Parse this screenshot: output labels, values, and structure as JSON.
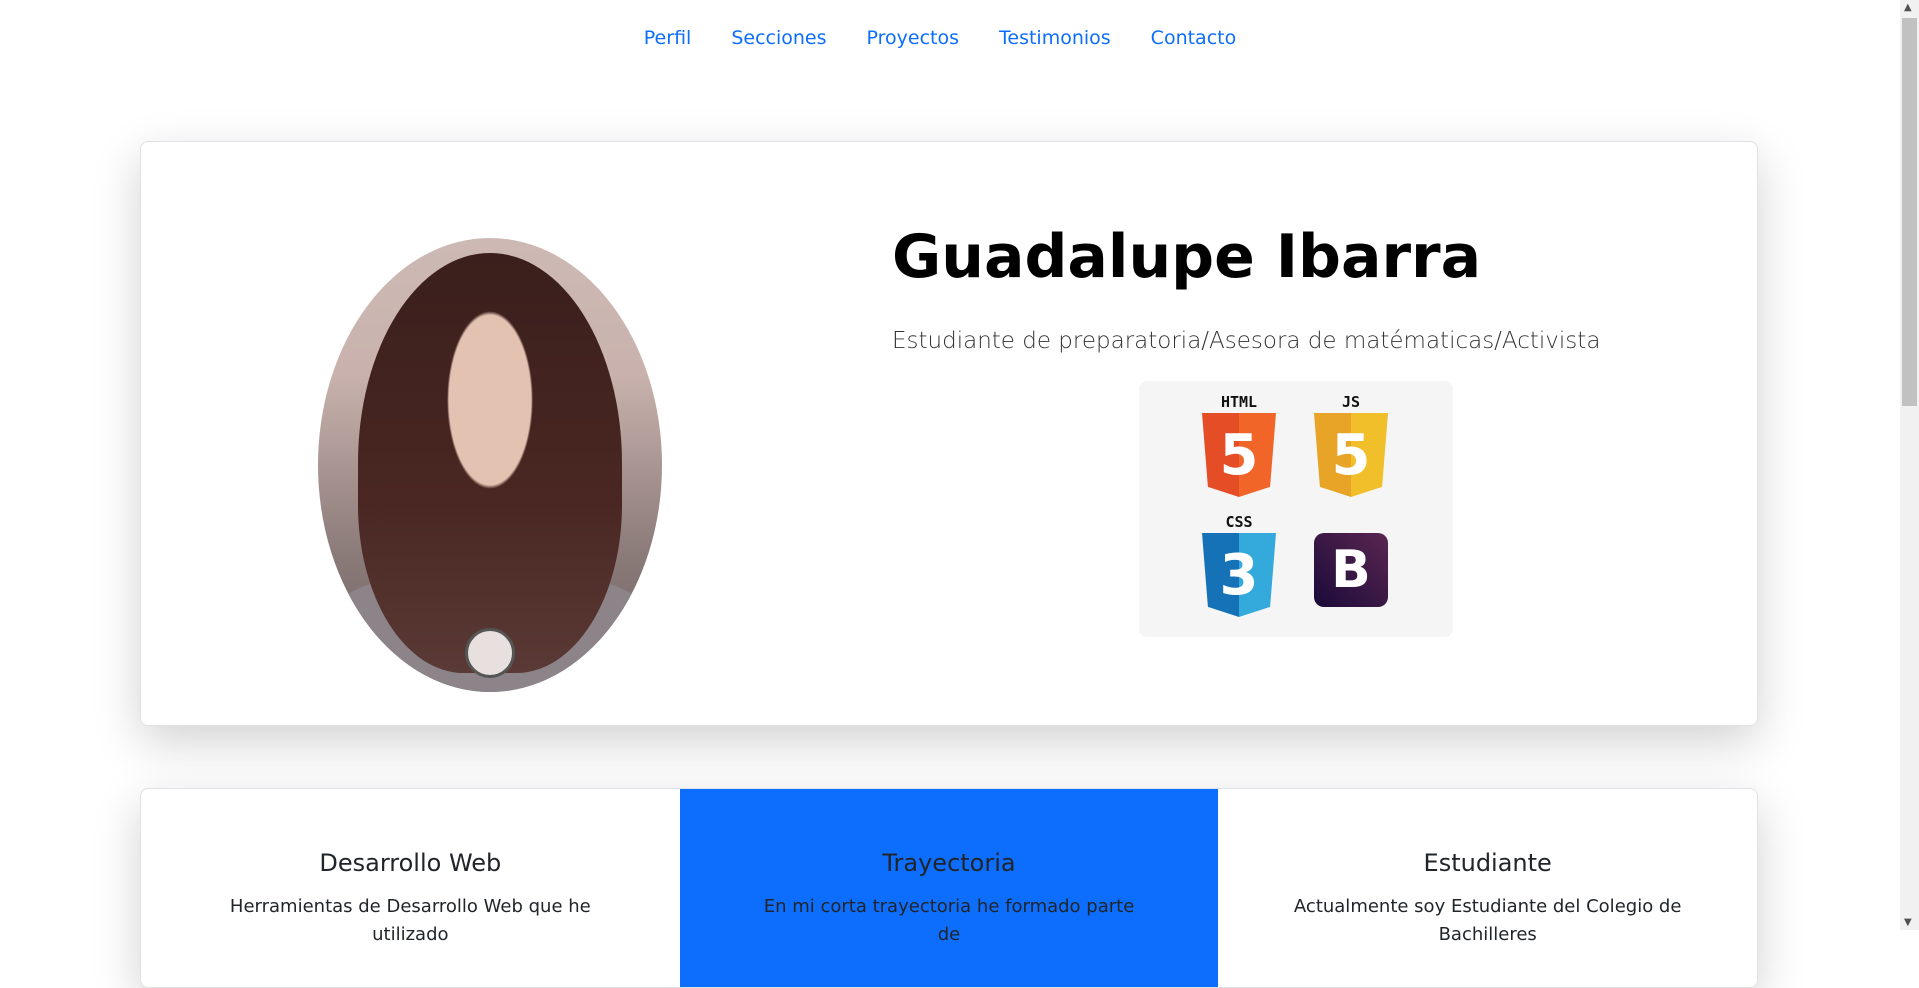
{
  "nav": {
    "items": [
      "Perfil",
      "Secciones",
      "Proyectos",
      "Testimonios",
      "Contacto"
    ]
  },
  "profile": {
    "name": "Guadalupe Ibarra",
    "subtitle": "Estudiante de preparatoria/Asesora de matématicas/Activista",
    "logos": [
      {
        "label": "HTML",
        "glyph": "5",
        "color": "#e44d26"
      },
      {
        "label": "JS",
        "glyph": "5",
        "color": "#e8a427"
      },
      {
        "label": "CSS",
        "glyph": "3",
        "color": "#1572b6"
      },
      {
        "label": "",
        "glyph": "B",
        "color": "#3b1a4a"
      }
    ]
  },
  "sections": [
    {
      "title": "Desarrollo Web",
      "text": "Herramientas de Desarrollo Web que he utilizado"
    },
    {
      "title": "Trayectoria",
      "text": "En mi corta trayectoria he formado parte de"
    },
    {
      "title": "Estudiante",
      "text": "Actualmente soy Estudiante del Colegio de Bachilleres"
    }
  ],
  "colors": {
    "accent": "#0d6efd"
  }
}
